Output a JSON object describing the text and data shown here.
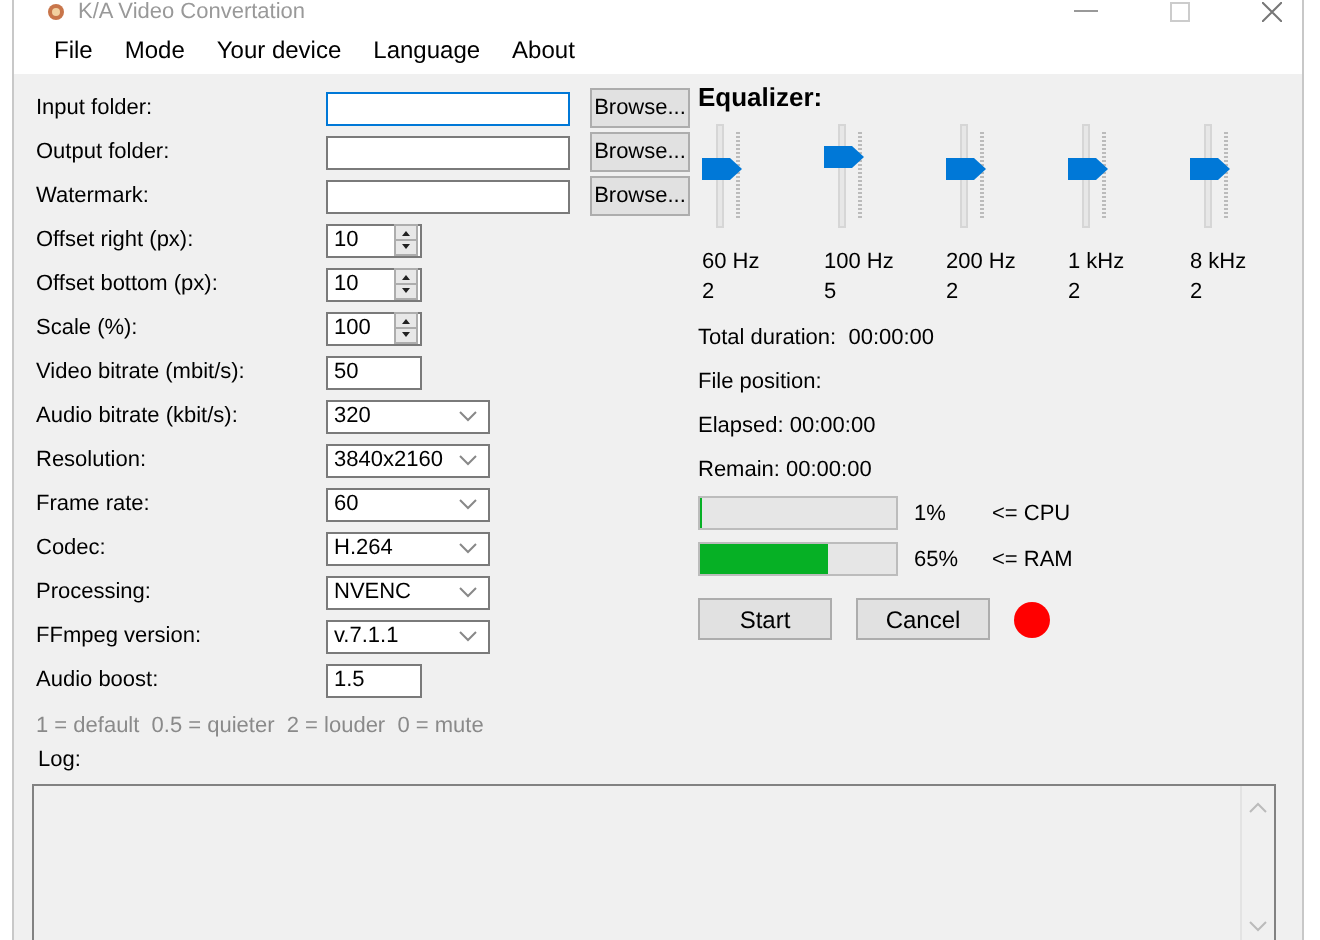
{
  "window": {
    "title": "K/A Video Convertation"
  },
  "menu": [
    {
      "label": "File"
    },
    {
      "label": "Mode"
    },
    {
      "label": "Your device"
    },
    {
      "label": "Language"
    },
    {
      "label": "About"
    }
  ],
  "form": {
    "rows": [
      {
        "label": "Input folder:",
        "kind": "text",
        "focused": true,
        "button": "Browse..."
      },
      {
        "label": "Output folder:",
        "kind": "text",
        "focused": false,
        "button": "Browse..."
      },
      {
        "label": "Watermark:",
        "kind": "text",
        "focused": false,
        "button": "Browse..."
      },
      {
        "label": "Offset right (px):",
        "kind": "spin",
        "value": "10",
        "focused": false
      },
      {
        "label": "Offset bottom (px):",
        "kind": "spin",
        "value": "10",
        "focused": false
      },
      {
        "label": "Scale (%):",
        "kind": "spin",
        "value": "100",
        "focused": false
      },
      {
        "label": "Video bitrate (mbit/s):",
        "kind": "short",
        "value": "50",
        "focused": false
      },
      {
        "label": "Audio bitrate (kbit/s):",
        "kind": "combo",
        "value": "320",
        "focused": false
      },
      {
        "label": "Resolution:",
        "kind": "combo",
        "value": "3840x2160",
        "focused": false
      },
      {
        "label": "Frame rate:",
        "kind": "combo",
        "value": "60",
        "focused": false
      },
      {
        "label": "Codec:",
        "kind": "combo",
        "value": "H.264",
        "focused": false
      },
      {
        "label": "Processing:",
        "kind": "combo",
        "value": "NVENC",
        "focused": false
      },
      {
        "label": "FFmpeg version:",
        "kind": "combo",
        "value": "v.7.1.1",
        "focused": false
      },
      {
        "label": "Audio boost:",
        "kind": "short",
        "value": "1.5",
        "focused": false
      }
    ],
    "hint": "1 = default  0.5 = quieter  2 = louder  0 = mute"
  },
  "equalizer": {
    "title": "Equalizer:",
    "bands": [
      {
        "label": "60 Hz",
        "reading": "2",
        "level": 0.6
      },
      {
        "label": "100 Hz",
        "reading": "5",
        "level": 0.75
      },
      {
        "label": "200 Hz",
        "reading": "2",
        "level": 0.6
      },
      {
        "label": "1 kHz",
        "reading": "2",
        "level": 0.6
      },
      {
        "label": "8 kHz",
        "reading": "2",
        "level": 0.6
      }
    ]
  },
  "status": [
    "Total duration:  00:00:00",
    "File position:",
    "Elapsed: 00:00:00",
    "Remain: 00:00:00"
  ],
  "meters": [
    {
      "level": 0.01,
      "reading": "1%",
      "label": "<= CPU"
    },
    {
      "level": 0.65,
      "reading": "65%",
      "label": "<= RAM"
    }
  ],
  "buttons": [
    {
      "label": "Start"
    },
    {
      "label": "Cancel"
    }
  ],
  "status_dot": {
    "color": "#ff0000"
  },
  "log": {
    "label": "Log:"
  }
}
